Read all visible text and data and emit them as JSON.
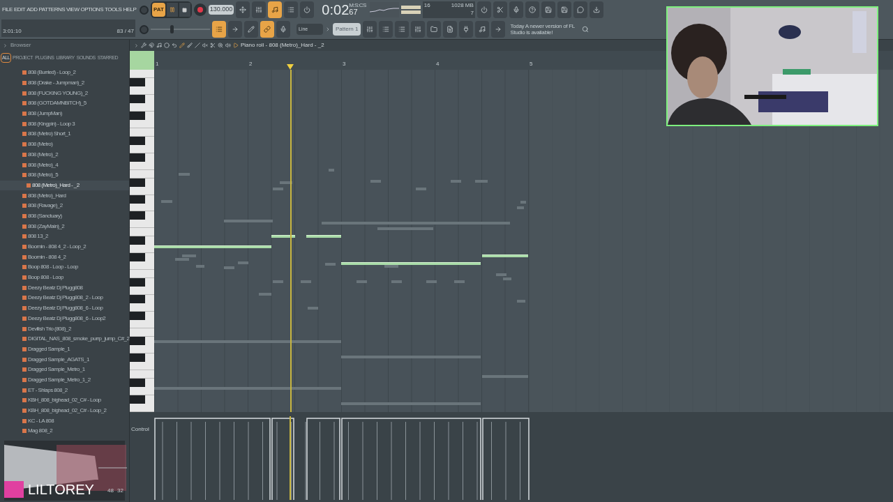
{
  "menu": [
    "FILE",
    "EDIT",
    "ADD",
    "PATTERNS",
    "VIEW",
    "OPTIONS",
    "TOOLS",
    "HELP"
  ],
  "hint_panel": {
    "position": "3:01:10",
    "count": "83 / 47"
  },
  "transport": {
    "mode": "PAT",
    "tempo": "130.000",
    "recording": true
  },
  "time": {
    "value": "0:02",
    "fraction": "67",
    "unit": "M:S:CS"
  },
  "monitor": {
    "voices": "16",
    "memory": "1028 MB",
    "cpu": "7"
  },
  "snap": "Line",
  "pattern": "Pattern 1",
  "news": "Today A newer version of FL Studio is available!",
  "browser": {
    "title": "Browser",
    "tabs": [
      {
        "label": "ALL",
        "selected": true
      },
      {
        "label": "PROJECT",
        "selected": false
      },
      {
        "label": "PLUGINS",
        "selected": false
      },
      {
        "label": "LIBRARY",
        "selected": false
      },
      {
        "label": "SOUNDS",
        "selected": false
      },
      {
        "label": "STARRED",
        "selected": false
      }
    ],
    "files": [
      {
        "name": "808 (Burried) - Loop_2",
        "selected": false
      },
      {
        "name": "808 (Drake - Jumpman)_2",
        "selected": false
      },
      {
        "name": "808 (FUCKING YOUNG)_2",
        "selected": false
      },
      {
        "name": "808 (GOTDAMNBITCH)_5",
        "selected": false
      },
      {
        "name": "808 (JumpMan)",
        "selected": false
      },
      {
        "name": "808 (Kingpin) - Loop 3",
        "selected": false
      },
      {
        "name": "808 (Metro) Short_1",
        "selected": false
      },
      {
        "name": "808 (Metro)",
        "selected": false
      },
      {
        "name": "808 (Metro)_2",
        "selected": false
      },
      {
        "name": "808 (Metro)_4",
        "selected": false
      },
      {
        "name": "808 (Metro)_5",
        "selected": false
      },
      {
        "name": "808 (Metro)_Hard - _2",
        "selected": true
      },
      {
        "name": "808 (Metro)_Hard",
        "selected": false
      },
      {
        "name": "808 (Ravage)_2",
        "selected": false
      },
      {
        "name": "808 (Sanctuary)",
        "selected": false
      },
      {
        "name": "808 (ZayMain)_2",
        "selected": false
      },
      {
        "name": "808 13_2",
        "selected": false
      },
      {
        "name": "Boomin - 808 4_2 - Loop_2",
        "selected": false
      },
      {
        "name": "Boomin - 808 4_2",
        "selected": false
      },
      {
        "name": "Boop 808  - Loop - Loop",
        "selected": false
      },
      {
        "name": "Boop 808  - Loop",
        "selected": false
      },
      {
        "name": "Deezy Beatz Dj Plugg808",
        "selected": false
      },
      {
        "name": "Deezy Beatz Dj Plugg808_2 - Loop",
        "selected": false
      },
      {
        "name": "Deezy Beatz Dj Plugg808_6 - Loop",
        "selected": false
      },
      {
        "name": "Deezy Beatz Dj Plugg808_6 - Loop2",
        "selected": false
      },
      {
        "name": "Devilish Trio (808)_2",
        "selected": false
      },
      {
        "name": "DIGITAL_NAS_808_smoke_purrp_jump_C#_2",
        "selected": false
      },
      {
        "name": "Dragged Sample_1",
        "selected": false
      },
      {
        "name": "Dragged Sample_AGATS_1",
        "selected": false
      },
      {
        "name": "Dragged Sample_Metro_1",
        "selected": false
      },
      {
        "name": "Dragged Sample_Metro_1_2",
        "selected": false
      },
      {
        "name": "ET - Shlaps 808_2",
        "selected": false
      },
      {
        "name": "KBH_808_bighead_02_C# - Loop",
        "selected": false
      },
      {
        "name": "KBH_808_bighead_02_C# - Loop_2",
        "selected": false
      },
      {
        "name": "KC - LA 808",
        "selected": false
      },
      {
        "name": "Mag 808_2",
        "selected": false
      }
    ],
    "sample_info": [
      "48",
      "32"
    ]
  },
  "piano_roll": {
    "title": "Piano roll - 808 (Metro)_Hard - _2",
    "bars": [
      "1",
      "2",
      "3",
      "4",
      "5"
    ],
    "event_label": "Control"
  },
  "overlay": {
    "name": "LILTOREY"
  }
}
